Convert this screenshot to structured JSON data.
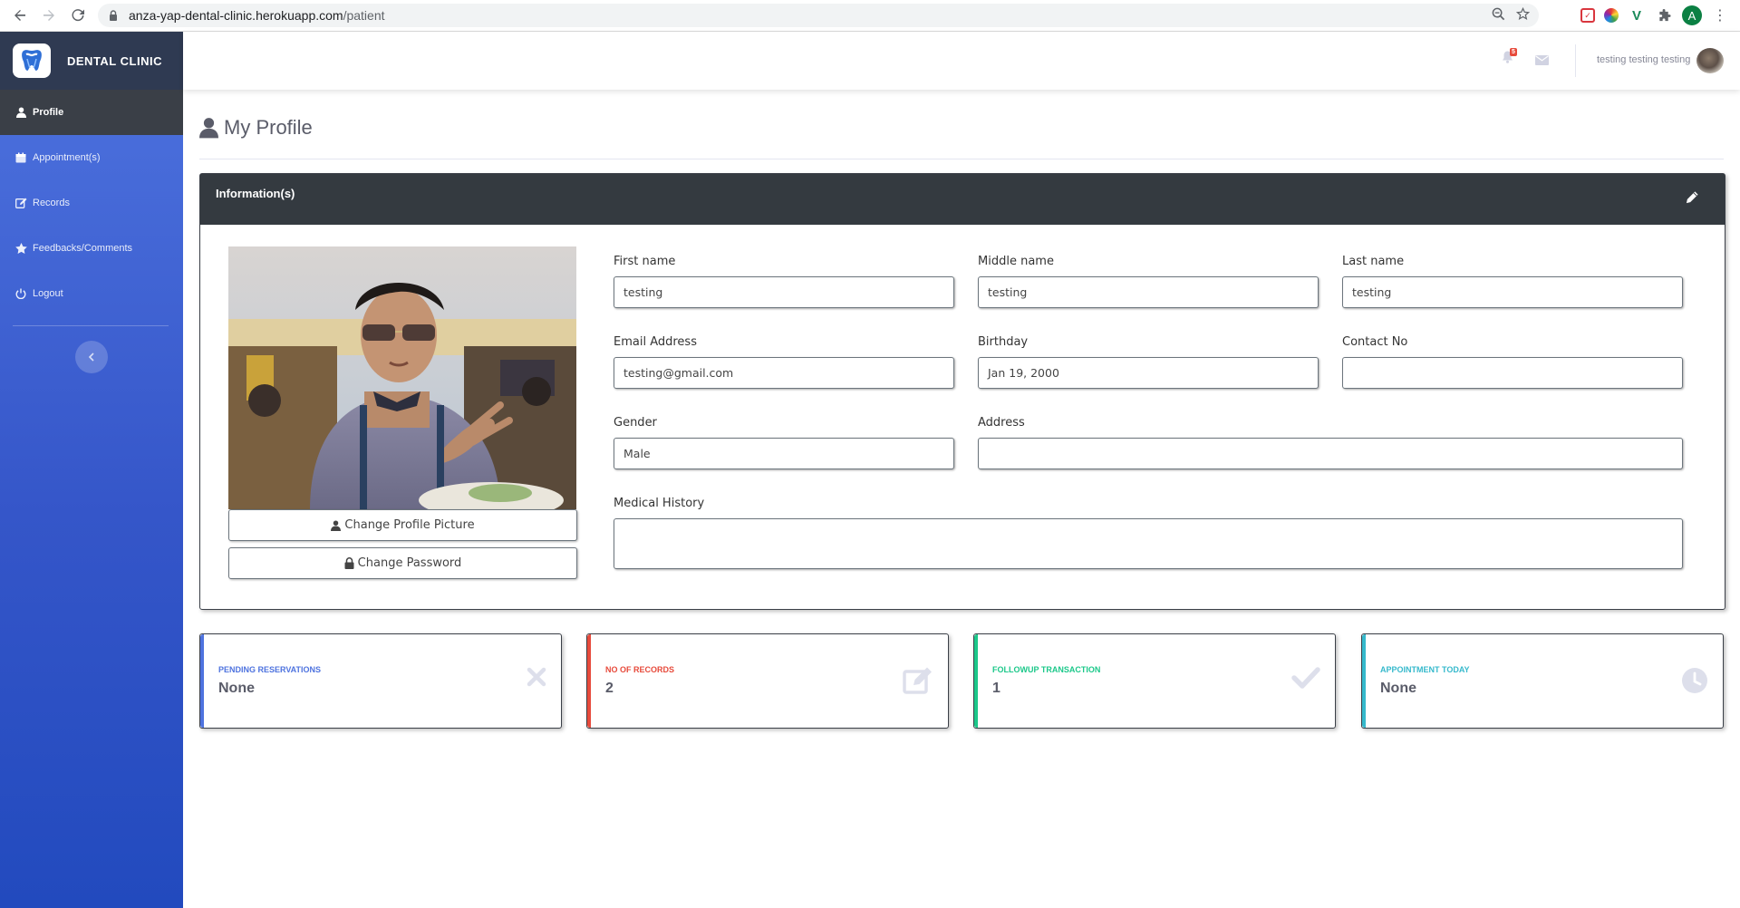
{
  "browser": {
    "url_host": "anza-yap-dental-clinic.herokuapp.com",
    "url_path": "/patient",
    "profile_initial": "A"
  },
  "sidebar": {
    "brand": "DENTAL CLINIC",
    "items": [
      {
        "label": "Profile",
        "icon": "user-icon",
        "active": true
      },
      {
        "label": "Appointment(s)",
        "icon": "calendar-icon",
        "active": false
      },
      {
        "label": "Records",
        "icon": "edit-icon",
        "active": false
      },
      {
        "label": "Feedbacks/Comments",
        "icon": "star-icon",
        "active": false
      },
      {
        "label": "Logout",
        "icon": "power-icon",
        "active": false
      }
    ]
  },
  "topbar": {
    "notification_count": "5",
    "user_name": "testing testing testing"
  },
  "page": {
    "title": "My Profile"
  },
  "info_card": {
    "header": "Information(s)",
    "change_picture_label": "Change Profile Picture",
    "change_password_label": "Change Password",
    "fields": {
      "first_name": {
        "label": "First name",
        "value": "testing"
      },
      "middle_name": {
        "label": "Middle name",
        "value": "testing"
      },
      "last_name": {
        "label": "Last name",
        "value": "testing"
      },
      "email": {
        "label": "Email Address",
        "value": "testing@gmail.com"
      },
      "birthday": {
        "label": "Birthday",
        "value": "Jan 19, 2000"
      },
      "contact": {
        "label": "Contact No",
        "value": ""
      },
      "gender": {
        "label": "Gender",
        "value": "Male"
      },
      "address": {
        "label": "Address",
        "value": ""
      },
      "medical_history": {
        "label": "Medical History",
        "value": ""
      }
    }
  },
  "stats": [
    {
      "label": "PENDING RESERVATIONS",
      "value": "None",
      "color": "#4e73df",
      "icon": "times-icon"
    },
    {
      "label": "NO OF RECORDS",
      "value": "2",
      "color": "#e74a3b",
      "icon": "edit-icon"
    },
    {
      "label": "FOLLOWUP TRANSACTION",
      "value": "1",
      "color": "#1cc88a",
      "icon": "check-icon"
    },
    {
      "label": "APPOINTMENT TODAY",
      "value": "None",
      "color": "#36b9cc",
      "icon": "clock-icon"
    }
  ],
  "colors": {
    "sidebar_top": "#4e73df",
    "sidebar_bottom": "#224abe",
    "card_header": "#343a40",
    "active_nav": "#3a3f47"
  }
}
